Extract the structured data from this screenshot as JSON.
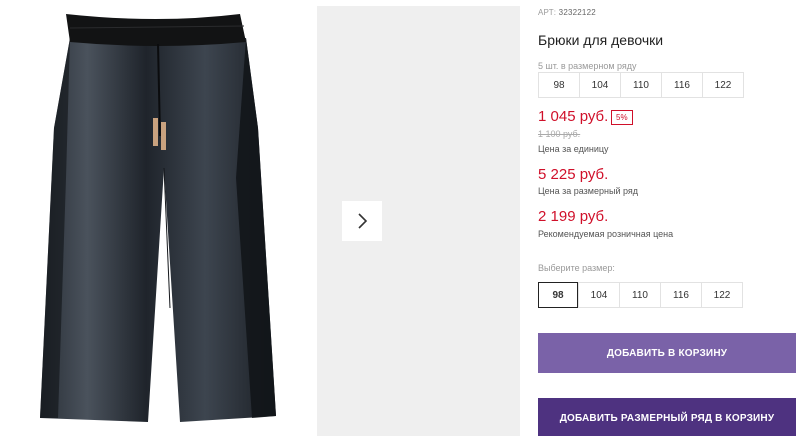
{
  "product": {
    "article_label": "АРТ:",
    "article_number": "32322122",
    "title": "Брюки для девочки",
    "row_caption": "5 шт. в размерном ряду",
    "row_sizes": [
      "98",
      "104",
      "110",
      "116",
      "122"
    ]
  },
  "pricing": {
    "unit_price": "1 045 руб.",
    "discount": "5%",
    "old_price": "1 100 руб.",
    "unit_caption": "Цена за единицу",
    "row_price": "5 225 руб.",
    "row_caption": "Цена за размерный ряд",
    "retail_price": "2 199 руб.",
    "retail_caption": "Рекомендуемая розничная цена",
    "accent_color": "#d0102a"
  },
  "size_select": {
    "label": "Выберите размер:",
    "options": [
      "98",
      "104",
      "110",
      "116",
      "122"
    ],
    "selected": "98"
  },
  "actions": {
    "add_to_cart": "ДОБАВИТЬ В КОРЗИНУ",
    "add_row_to_cart": "ДОБАВИТЬ РАЗМЕРНЫЙ РЯД В КОРЗИНУ",
    "add_to_cart_color": "#7a62a8",
    "add_row_color": "#4e3280"
  },
  "gallery": {
    "next_icon": "chevron-right-icon"
  }
}
